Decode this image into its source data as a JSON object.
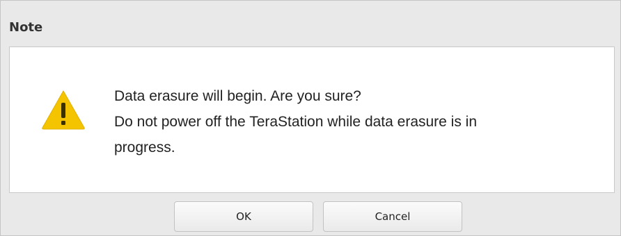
{
  "dialog": {
    "title": "Note",
    "icon": "warning-icon",
    "message_lines": [
      "Data erasure will begin. Are you sure?",
      "Do not power off the TeraStation while data erasure is in",
      "progress."
    ],
    "buttons": {
      "ok_label": "OK",
      "cancel_label": "Cancel"
    },
    "colors": {
      "warning_fill": "#f5c400",
      "warning_mark": "#3a3000",
      "panel_background": "#e9e9e9"
    }
  }
}
